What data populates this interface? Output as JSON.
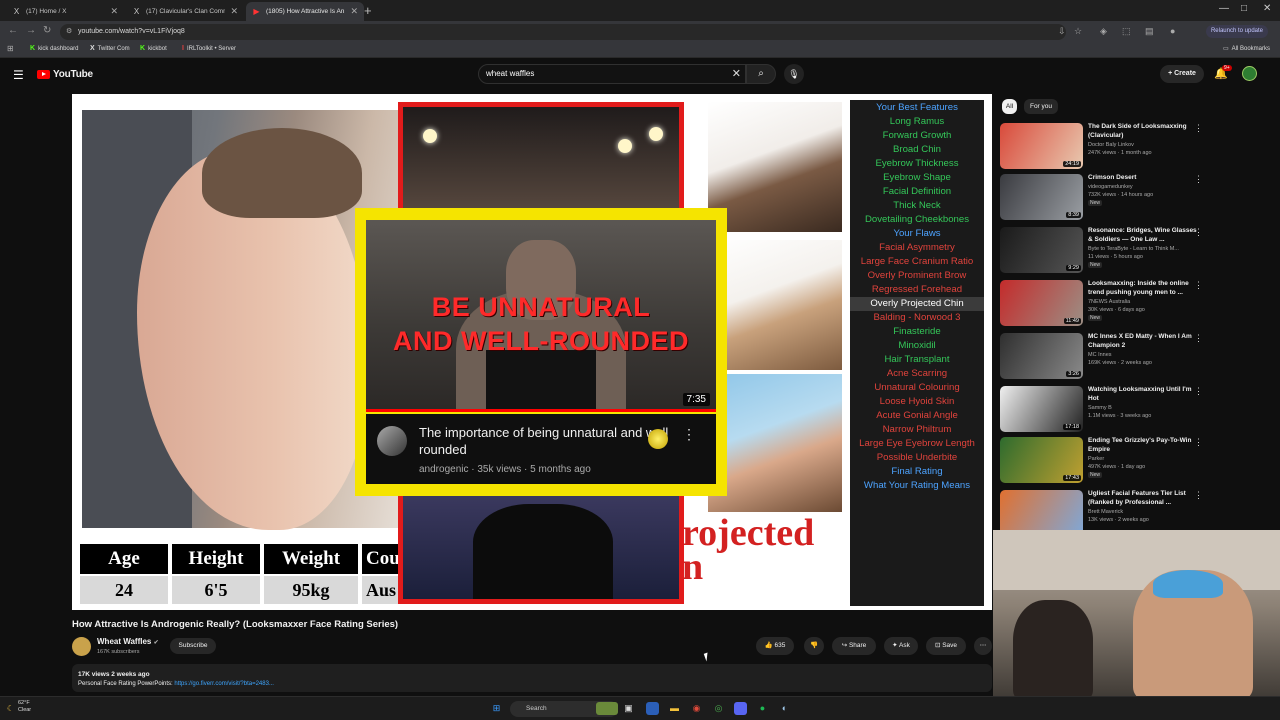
{
  "browser": {
    "tabs": [
      {
        "icon": "X",
        "title": "(17) Home / X",
        "active": false
      },
      {
        "icon": "X",
        "title": "(17) Clavicular's Clan Communi...",
        "active": false
      },
      {
        "icon": "▶",
        "title": "(1805) How Attractive Is An...",
        "active": true
      }
    ],
    "url": "youtube.com/watch?v=vL1FiVjoq8",
    "relaunch_label": "Relaunch to update",
    "bookmarks": [
      {
        "icon": "K",
        "label": "kick dashboard"
      },
      {
        "icon": "X",
        "label": "Twitter Com"
      },
      {
        "icon": "K",
        "label": "kickbot"
      },
      {
        "icon": "I",
        "label": "IRLToolkit • Server"
      }
    ],
    "all_bookmarks": "All Bookmarks"
  },
  "yt": {
    "logo": "YouTube",
    "search_value": "wheat waffles",
    "create_label": "Create",
    "notif_count": "9+"
  },
  "player": {
    "stats_headers": [
      "Age",
      "Height",
      "Weight",
      "Cou"
    ],
    "stats_values": [
      "24",
      "6'5",
      "95kg",
      "Aus"
    ],
    "projected_text": [
      "rojected",
      "n"
    ],
    "features": [
      {
        "label": "Your Best Features",
        "color": "#4da3ff"
      },
      {
        "label": "Long Ramus",
        "color": "#34c759"
      },
      {
        "label": "Forward Growth",
        "color": "#34c759"
      },
      {
        "label": "Broad Chin",
        "color": "#34c759"
      },
      {
        "label": "Eyebrow Thickness",
        "color": "#34c759"
      },
      {
        "label": "Eyebrow Shape",
        "color": "#34c759"
      },
      {
        "label": "Facial Definition",
        "color": "#34c759"
      },
      {
        "label": "Thick Neck",
        "color": "#34c759"
      },
      {
        "label": "Dovetailing Cheekbones",
        "color": "#34c759"
      },
      {
        "label": "Your Flaws",
        "color": "#4da3ff"
      },
      {
        "label": "Facial Asymmetry",
        "color": "#e0433c"
      },
      {
        "label": "Large Face Cranium Ratio",
        "color": "#e0433c"
      },
      {
        "label": "Overly Prominent Brow",
        "color": "#e0433c"
      },
      {
        "label": "Regressed Forehead",
        "color": "#e0433c"
      },
      {
        "label": "Overly Projected Chin",
        "color": "#ffffff",
        "selected": true
      },
      {
        "label": "Balding - Norwood 3",
        "color": "#e0433c"
      },
      {
        "label": "Finasteride",
        "color": "#34c759"
      },
      {
        "label": "Minoxidil",
        "color": "#34c759"
      },
      {
        "label": "Hair Transplant",
        "color": "#34c759"
      },
      {
        "label": "Acne Scarring",
        "color": "#e0433c"
      },
      {
        "label": "Unnatural Colouring",
        "color": "#e0433c"
      },
      {
        "label": "Loose Hyoid Skin",
        "color": "#e0433c"
      },
      {
        "label": "Acute Gonial Angle",
        "color": "#e0433c"
      },
      {
        "label": "Narrow Philtrum",
        "color": "#e0433c"
      },
      {
        "label": "Large Eye Eyebrow Length",
        "color": "#e0433c"
      },
      {
        "label": "Possible Underbite",
        "color": "#e0433c"
      },
      {
        "label": "Final Rating",
        "color": "#4da3ff"
      },
      {
        "label": "What Your Rating Means",
        "color": "#4da3ff"
      }
    ],
    "card": {
      "headline_1": "BE UNNATURAL",
      "headline_2": "AND WELL-ROUNDED",
      "duration": "7:35",
      "title": "The importance of being unnatural and well rounded",
      "meta": "androgenic · 35k views · 5 months ago",
      "progress": 1.0
    }
  },
  "video": {
    "title": "How Attractive Is Androgenic Really? (Looksmaxxer Face Rating Series)",
    "channel": "Wheat Waffles",
    "subs": "167K subscribers",
    "subscribe": "Subscribe",
    "likes": "635",
    "share": "Share",
    "ask": "Ask",
    "save": "Save",
    "desc_line1": "17K views  2 weeks ago",
    "desc_line2_prefix": "Personal Face Rating PowerPoints: ",
    "desc_line2_link": "https://go.fiverr.com/visit/?bta=2483..."
  },
  "sidebar": {
    "chips": [
      "All",
      "For you"
    ],
    "recs": [
      {
        "title": "The Dark Side of Looksmaxxing (Clavicular)",
        "channel": "Doctor Baly Linkov",
        "views": "247K views · 1 month ago",
        "dur": "24:19",
        "new": "",
        "colors": [
          "#d94a3b",
          "#e8c9b0"
        ]
      },
      {
        "title": "Crimson Desert",
        "channel": "videogamedunkey",
        "views": "732K views · 14 hours ago",
        "dur": "8:39",
        "new": "New",
        "colors": [
          "#3a3b40",
          "#9a9ea3"
        ]
      },
      {
        "title": "Resonance: Bridges, Wine Glasses & Soldiers — One Law ...",
        "channel": "Byte to TeraByte - Learn to Think M...",
        "views": "11 views · 5 hours ago",
        "dur": "9:29",
        "new": "New",
        "colors": [
          "#1a1a1a",
          "#555"
        ]
      },
      {
        "title": "Looksmaxxing: Inside the online trend pushing young men to ...",
        "channel": "7NEWS Australia",
        "views": "30K views · 6 days ago",
        "dur": "11:49",
        "new": "New",
        "colors": [
          "#c42b2b",
          "#9c8f85"
        ]
      },
      {
        "title": "MC Innes X ED Matty - When I Am Champion 2",
        "channel": "MC Innes",
        "views": "169K views · 2 weeks ago",
        "dur": "3:26",
        "new": "",
        "colors": [
          "#2f2f2f",
          "#8a8a8a"
        ]
      },
      {
        "title": "Watching Looksmaxxing Until I'm Hot",
        "channel": "Sammy B",
        "views": "1.1M views · 3 weeks ago",
        "dur": "17:18",
        "new": "",
        "colors": [
          "#f0f0f0",
          "#222"
        ]
      },
      {
        "title": "Ending Tee Grizzley's Pay-To-Win Empire",
        "channel": "Parker",
        "views": "497K views · 1 day ago",
        "dur": "17:43",
        "new": "New",
        "colors": [
          "#2e6b2e",
          "#c0a030"
        ]
      },
      {
        "title": "Ugliest Facial Features Tier List (Ranked by Professional ...",
        "channel": "Brett Maverick",
        "views": "13K views · 2 weeks ago",
        "dur": "",
        "new": "",
        "colors": [
          "#e07030",
          "#7fa8d8"
        ]
      }
    ]
  },
  "taskbar": {
    "weather_temp": "62°F",
    "weather_desc": "Clear",
    "search": "Search"
  },
  "colors": {
    "accent": "#ff0000",
    "link": "#3ea6ff"
  }
}
